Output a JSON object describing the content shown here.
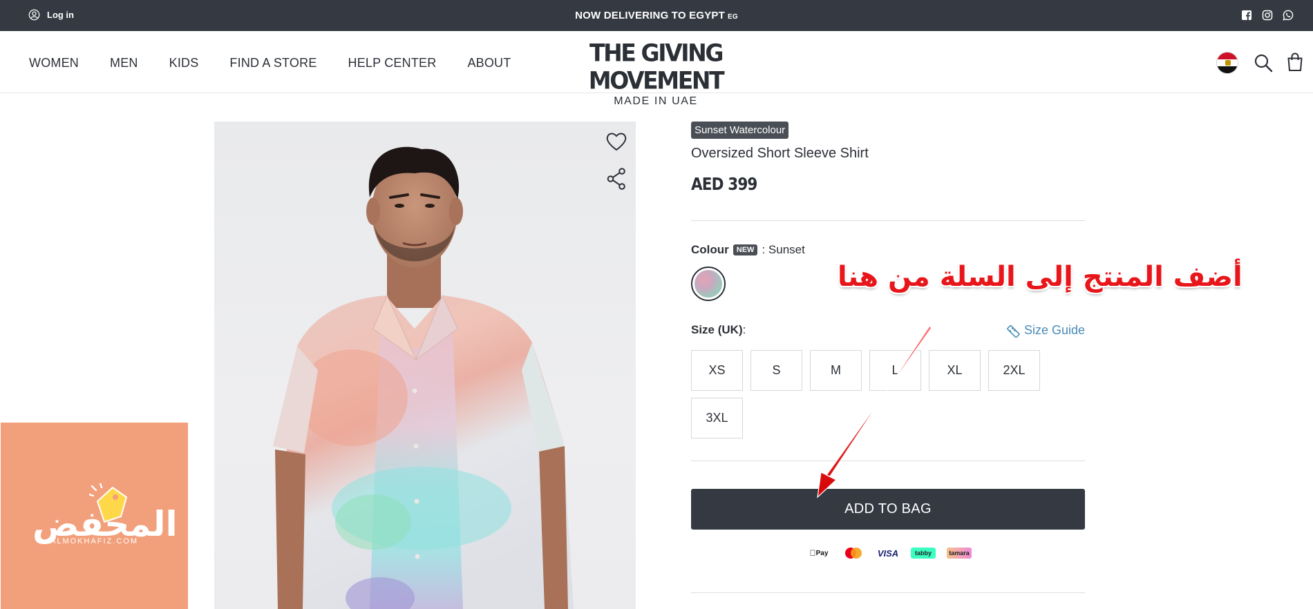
{
  "topbar": {
    "login_label": "Log in",
    "announcement": "NOW DELIVERING TO EGYPT",
    "country_code": "EG",
    "social_icons": [
      "facebook-icon",
      "instagram-icon",
      "whatsapp-icon"
    ]
  },
  "header": {
    "nav": [
      "WOMEN",
      "MEN",
      "KIDS",
      "FIND A STORE",
      "HELP CENTER",
      "ABOUT"
    ],
    "logo_title": "THE GIVING MOVEMENT",
    "logo_subtitle": "MADE IN UAE",
    "icons": [
      "egypt-flag-icon",
      "search-icon",
      "bag-icon"
    ]
  },
  "product": {
    "badge": "Sunset Watercolour",
    "title": "Oversized Short Sleeve Shirt",
    "price": "AED 399",
    "colour_label": "Colour",
    "colour_new": "NEW",
    "colour_value": ": Sunset",
    "size_label": "Size (UK)",
    "size_colon": ":",
    "size_guide": "Size Guide",
    "sizes": [
      "XS",
      "S",
      "M",
      "L",
      "XL",
      "2XL",
      "3XL"
    ],
    "add_to_bag": "ADD TO BAG",
    "payments": [
      "Pay",
      "VISA",
      "tabby",
      "tamara"
    ]
  },
  "overlay": {
    "annotation_text": "أضف المنتج إلى السلة من هنا",
    "watermark_arabic": "المحفض",
    "watermark_latin": "ALMOKHAFIZ.COM"
  },
  "colors": {
    "dark": "#353a42",
    "link": "#4a8bb6",
    "annotation": "#e8161a",
    "watermark_bg": "#f2a07b"
  }
}
